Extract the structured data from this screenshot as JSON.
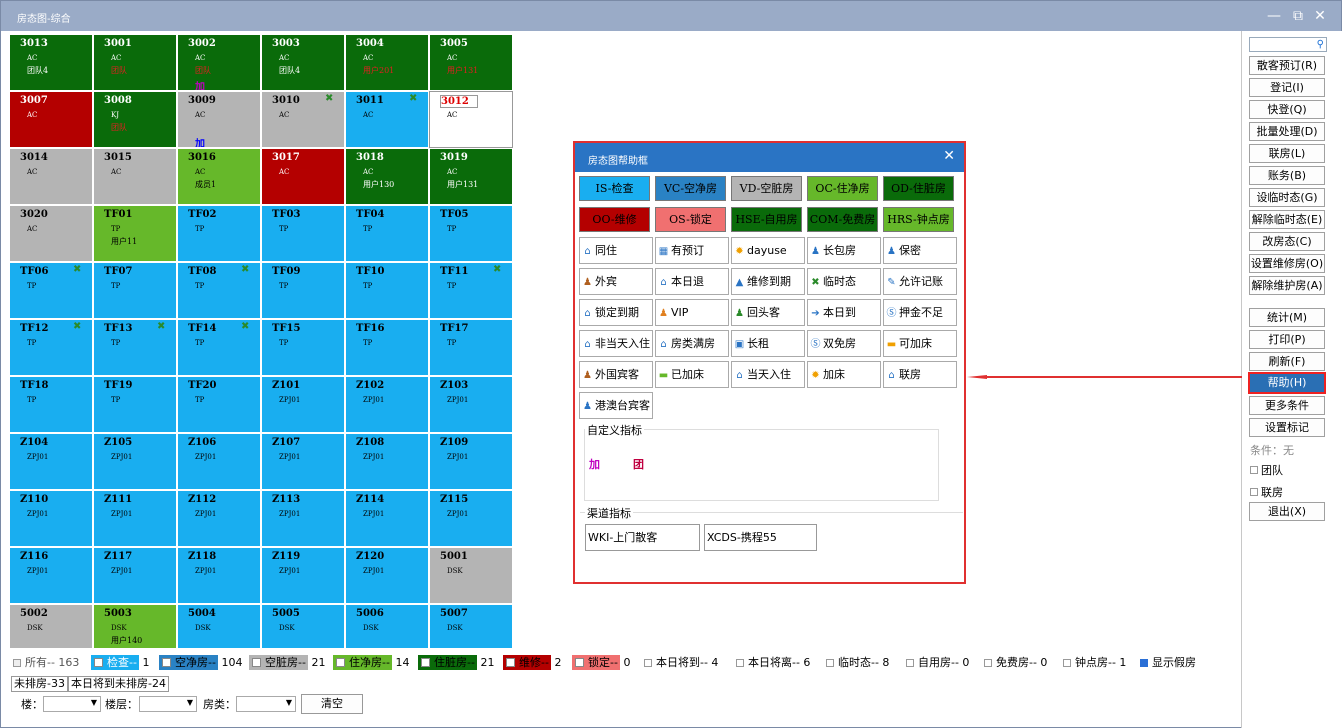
{
  "window": {
    "title": "房态图-综合",
    "minimize": "—",
    "restore": "⧉",
    "close": "✕"
  },
  "rooms": [
    {
      "num": "3013",
      "type": "AC",
      "extra": "团队4",
      "mark": "",
      "color": "green",
      "icon": false
    },
    {
      "num": "3001",
      "type": "AC",
      "extra": "团队",
      "mark": "",
      "color": "green",
      "icon": false
    },
    {
      "num": "3002",
      "type": "AC",
      "extra": "团队",
      "mark": "加",
      "color": "green",
      "icon": false
    },
    {
      "num": "3003",
      "type": "AC",
      "extra": "团队4",
      "mark": "",
      "color": "green",
      "icon": false
    },
    {
      "num": "3004",
      "type": "AC",
      "extra": "用户201",
      "mark": "",
      "color": "green",
      "icon": false
    },
    {
      "num": "3005",
      "type": "AC",
      "extra": "用户131",
      "mark": "",
      "color": "green",
      "icon": false
    },
    {
      "num": "3007",
      "type": "AC",
      "extra": "",
      "mark": "",
      "color": "red",
      "icon": false
    },
    {
      "num": "3008",
      "type": "KJ",
      "extra": "团队",
      "mark": "",
      "color": "green",
      "icon": false
    },
    {
      "num": "3009",
      "type": "AC",
      "extra": "",
      "mark": "加",
      "color": "gray",
      "icon": false
    },
    {
      "num": "3010",
      "type": "AC",
      "extra": "",
      "mark": "",
      "color": "gray",
      "icon": true
    },
    {
      "num": "3011",
      "type": "AC",
      "extra": "",
      "mark": "",
      "color": "blue",
      "icon": true
    },
    {
      "num": "3012",
      "type": "AC",
      "extra": "",
      "mark": "",
      "color": "white",
      "icon": false
    },
    {
      "num": "3014",
      "type": "AC",
      "extra": "",
      "mark": "",
      "color": "gray",
      "icon": false
    },
    {
      "num": "3015",
      "type": "AC",
      "extra": "",
      "mark": "",
      "color": "gray",
      "icon": false
    },
    {
      "num": "3016",
      "type": "AC",
      "extra": "成员1",
      "mark": "",
      "color": "lgreen",
      "icon": false
    },
    {
      "num": "3017",
      "type": "AC",
      "extra": "",
      "mark": "",
      "color": "red",
      "icon": false
    },
    {
      "num": "3018",
      "type": "AC",
      "extra": "用户130",
      "mark": "",
      "color": "green",
      "icon": false
    },
    {
      "num": "3019",
      "type": "AC",
      "extra": "用户131",
      "mark": "",
      "color": "green",
      "icon": false
    },
    {
      "num": "3020",
      "type": "AC",
      "extra": "",
      "mark": "",
      "color": "gray",
      "icon": false
    },
    {
      "num": "TF01",
      "type": "TP",
      "extra": "用户11",
      "mark": "",
      "color": "lgreen",
      "icon": false
    },
    {
      "num": "TF02",
      "type": "TP",
      "extra": "",
      "mark": "",
      "color": "blue",
      "icon": false
    },
    {
      "num": "TF03",
      "type": "TP",
      "extra": "",
      "mark": "",
      "color": "blue",
      "icon": false
    },
    {
      "num": "TF04",
      "type": "TP",
      "extra": "",
      "mark": "",
      "color": "blue",
      "icon": false
    },
    {
      "num": "TF05",
      "type": "TP",
      "extra": "",
      "mark": "",
      "color": "blue",
      "icon": false
    },
    {
      "num": "TF06",
      "type": "TP",
      "extra": "",
      "mark": "",
      "color": "blue",
      "icon": true
    },
    {
      "num": "TF07",
      "type": "TP",
      "extra": "",
      "mark": "",
      "color": "blue",
      "icon": false
    },
    {
      "num": "TF08",
      "type": "TP",
      "extra": "",
      "mark": "",
      "color": "blue",
      "icon": true
    },
    {
      "num": "TF09",
      "type": "TP",
      "extra": "",
      "mark": "",
      "color": "blue",
      "icon": false
    },
    {
      "num": "TF10",
      "type": "TP",
      "extra": "",
      "mark": "",
      "color": "blue",
      "icon": false
    },
    {
      "num": "TF11",
      "type": "TP",
      "extra": "",
      "mark": "",
      "color": "blue",
      "icon": true
    },
    {
      "num": "TF12",
      "type": "TP",
      "extra": "",
      "mark": "",
      "color": "blue",
      "icon": true
    },
    {
      "num": "TF13",
      "type": "TP",
      "extra": "",
      "mark": "",
      "color": "blue",
      "icon": true
    },
    {
      "num": "TF14",
      "type": "TP",
      "extra": "",
      "mark": "",
      "color": "blue",
      "icon": true
    },
    {
      "num": "TF15",
      "type": "TP",
      "extra": "",
      "mark": "",
      "color": "blue",
      "icon": false
    },
    {
      "num": "TF16",
      "type": "TP",
      "extra": "",
      "mark": "",
      "color": "blue",
      "icon": false
    },
    {
      "num": "TF17",
      "type": "TP",
      "extra": "",
      "mark": "",
      "color": "blue",
      "icon": false
    },
    {
      "num": "TF18",
      "type": "TP",
      "extra": "",
      "mark": "",
      "color": "blue",
      "icon": false
    },
    {
      "num": "TF19",
      "type": "TP",
      "extra": "",
      "mark": "",
      "color": "blue",
      "icon": false
    },
    {
      "num": "TF20",
      "type": "TP",
      "extra": "",
      "mark": "",
      "color": "blue",
      "icon": false
    },
    {
      "num": "Z101",
      "type": "ZPJ01",
      "extra": "",
      "mark": "",
      "color": "blue",
      "icon": false
    },
    {
      "num": "Z102",
      "type": "ZPJ01",
      "extra": "",
      "mark": "",
      "color": "blue",
      "icon": false
    },
    {
      "num": "Z103",
      "type": "ZPJ01",
      "extra": "",
      "mark": "",
      "color": "blue",
      "icon": false
    },
    {
      "num": "Z104",
      "type": "ZPJ01",
      "extra": "",
      "mark": "",
      "color": "blue",
      "icon": false
    },
    {
      "num": "Z105",
      "type": "ZPJ01",
      "extra": "",
      "mark": "",
      "color": "blue",
      "icon": false
    },
    {
      "num": "Z106",
      "type": "ZPJ01",
      "extra": "",
      "mark": "",
      "color": "blue",
      "icon": false
    },
    {
      "num": "Z107",
      "type": "ZPJ01",
      "extra": "",
      "mark": "",
      "color": "blue",
      "icon": false
    },
    {
      "num": "Z108",
      "type": "ZPJ01",
      "extra": "",
      "mark": "",
      "color": "blue",
      "icon": false
    },
    {
      "num": "Z109",
      "type": "ZPJ01",
      "extra": "",
      "mark": "",
      "color": "blue",
      "icon": false
    },
    {
      "num": "Z110",
      "type": "ZPJ01",
      "extra": "",
      "mark": "",
      "color": "blue",
      "icon": false
    },
    {
      "num": "Z111",
      "type": "ZPJ01",
      "extra": "",
      "mark": "",
      "color": "blue",
      "icon": false
    },
    {
      "num": "Z112",
      "type": "ZPJ01",
      "extra": "",
      "mark": "",
      "color": "blue",
      "icon": false
    },
    {
      "num": "Z113",
      "type": "ZPJ01",
      "extra": "",
      "mark": "",
      "color": "blue",
      "icon": false
    },
    {
      "num": "Z114",
      "type": "ZPJ01",
      "extra": "",
      "mark": "",
      "color": "blue",
      "icon": false
    },
    {
      "num": "Z115",
      "type": "ZPJ01",
      "extra": "",
      "mark": "",
      "color": "blue",
      "icon": false
    },
    {
      "num": "Z116",
      "type": "ZPJ01",
      "extra": "",
      "mark": "",
      "color": "blue",
      "icon": false
    },
    {
      "num": "Z117",
      "type": "ZPJ01",
      "extra": "",
      "mark": "",
      "color": "blue",
      "icon": false
    },
    {
      "num": "Z118",
      "type": "ZPJ01",
      "extra": "",
      "mark": "",
      "color": "blue",
      "icon": false
    },
    {
      "num": "Z119",
      "type": "ZPJ01",
      "extra": "",
      "mark": "",
      "color": "blue",
      "icon": false
    },
    {
      "num": "Z120",
      "type": "ZPJ01",
      "extra": "",
      "mark": "",
      "color": "blue",
      "icon": false
    },
    {
      "num": "5001",
      "type": "DSK",
      "extra": "",
      "mark": "",
      "color": "gray",
      "icon": false
    },
    {
      "num": "5002",
      "type": "DSK",
      "extra": "",
      "mark": "",
      "color": "gray",
      "icon": false
    },
    {
      "num": "5003",
      "type": "DSK",
      "extra": "用户140",
      "mark": "",
      "color": "lgreen",
      "icon": false
    },
    {
      "num": "5004",
      "type": "DSK",
      "extra": "",
      "mark": "",
      "color": "blue",
      "icon": false
    },
    {
      "num": "5005",
      "type": "DSK",
      "extra": "",
      "mark": "",
      "color": "blue",
      "icon": false
    },
    {
      "num": "5006",
      "type": "DSK",
      "extra": "",
      "mark": "",
      "color": "blue",
      "icon": false
    },
    {
      "num": "5007",
      "type": "DSK",
      "extra": "",
      "mark": "",
      "color": "blue",
      "icon": false
    }
  ],
  "sidebar": {
    "search_icon": "search-icon",
    "buttons": [
      "散客预订(R)",
      "登记(I)",
      "快登(Q)",
      "批量处理(D)",
      "联房(L)",
      "账务(B)",
      "设临时态(G)",
      "解除临时态(E)",
      "改房态(C)",
      "设置维修房(O)",
      "解除维护房(A)",
      "统计(M)",
      "打印(P)",
      "刷新(F)",
      "帮助(H)",
      "更多条件",
      "设置标记"
    ],
    "condition": "条件：无",
    "check_team": "团队",
    "check_link": "联房",
    "exit": "退出(X)"
  },
  "legend": {
    "all": "所有-- 163",
    "check": "检查--",
    "check_n": "1",
    "vc": "空净房--",
    "vc_n": "104",
    "vd": "空脏房--",
    "vd_n": "21",
    "oc": "住净房--",
    "oc_n": "14",
    "od": "住脏房--",
    "od_n": "21",
    "oo": "维修--",
    "oo_n": "2",
    "os": "锁定--",
    "os_n": "0",
    "arrive": "本日将到-- 4",
    "leave": "本日将离-- 6",
    "temp": "临时态-- 8",
    "self": "自用房-- 0",
    "free": "免费房-- 0",
    "hour": "钟点房-- 1",
    "show_fake": "显示假房",
    "unassigned": "未排房-33",
    "arrive_unassigned": "本日将到未排房-24",
    "building": "楼：",
    "floor": "楼层：",
    "roomtype": "房类：",
    "clear": "清空"
  },
  "colors": {
    "green": "#0a6b0a",
    "red": "#b40000",
    "gray": "#b4b4b4",
    "blue": "#19aef0",
    "lgreen": "#66b82a",
    "accent": "#2a74c4",
    "highlight": "#e03030"
  },
  "dialog": {
    "title": "房态图帮助框",
    "close": "✕",
    "statuses": [
      {
        "label": "IS-检查",
        "bg": "#19aef0",
        "fg": "#000"
      },
      {
        "label": "VC-空净房",
        "bg": "#2a82c4",
        "fg": "#000"
      },
      {
        "label": "VD-空脏房",
        "bg": "#b4b4b4",
        "fg": "#000"
      },
      {
        "label": "OC-住净房",
        "bg": "#66b82a",
        "fg": "#000"
      },
      {
        "label": "OD-住脏房",
        "bg": "#0a6b0a",
        "fg": "#000"
      },
      {
        "label": "OO-维修",
        "bg": "#b40000",
        "fg": "#000"
      },
      {
        "label": "OS-锁定",
        "bg": "#f07070",
        "fg": "#000"
      },
      {
        "label": "HSE-自用房",
        "bg": "#0a6b0a",
        "fg": "#000"
      },
      {
        "label": "COM-免费房",
        "bg": "#0a6b0a",
        "fg": "#000"
      },
      {
        "label": "HRS-钟点房",
        "bg": "#66b82a",
        "fg": "#000"
      }
    ],
    "indicators": [
      {
        "label": "同住",
        "icon": "home-icon",
        "glyph": "⌂",
        "color": "#2a74c4"
      },
      {
        "label": "有预订",
        "icon": "calendar-icon",
        "glyph": "▦",
        "color": "#2a74c4"
      },
      {
        "label": "dayuse",
        "icon": "sun-icon",
        "glyph": "✹",
        "color": "#f0a000"
      },
      {
        "label": "长包房",
        "icon": "person-key-icon",
        "glyph": "♟",
        "color": "#2a74c4"
      },
      {
        "label": "保密",
        "icon": "person-lock-icon",
        "glyph": "♟",
        "color": "#2a74c4"
      },
      {
        "label": "外宾",
        "icon": "foreigner-icon",
        "glyph": "♟",
        "color": "#b06020"
      },
      {
        "label": "本日退",
        "icon": "checkout-icon",
        "glyph": "⌂",
        "color": "#2a74c4"
      },
      {
        "label": "维修到期",
        "icon": "repair-icon",
        "glyph": "▲",
        "color": "#2a74c4"
      },
      {
        "label": "临时态",
        "icon": "tools-icon",
        "glyph": "✖",
        "color": "#2a8a2a"
      },
      {
        "label": "允许记账",
        "icon": "account-icon",
        "glyph": "✎",
        "color": "#2a74c4"
      },
      {
        "label": "锁定到期",
        "icon": "lock-home-icon",
        "glyph": "⌂",
        "color": "#2a74c4"
      },
      {
        "label": "VIP",
        "icon": "vip-icon",
        "glyph": "♟",
        "color": "#e08020"
      },
      {
        "label": "回头客",
        "icon": "returning-guest-icon",
        "glyph": "♟",
        "color": "#2a8a2a"
      },
      {
        "label": "本日到",
        "icon": "arrival-icon",
        "glyph": "➔",
        "color": "#2a74c4"
      },
      {
        "label": "押金不足",
        "icon": "deposit-icon",
        "glyph": "Ⓢ",
        "color": "#2a74c4"
      },
      {
        "label": "非当天入住",
        "icon": "house-icon",
        "glyph": "⌂",
        "color": "#2a74c4"
      },
      {
        "label": "房类满房",
        "icon": "house-full-icon",
        "glyph": "⌂",
        "color": "#2a74c4"
      },
      {
        "label": "长租",
        "icon": "long-rent-icon",
        "glyph": "▣",
        "color": "#2a74c4"
      },
      {
        "label": "双免房",
        "icon": "double-free-icon",
        "glyph": "Ⓢ",
        "color": "#2a74c4"
      },
      {
        "label": "可加床",
        "icon": "bed-icon",
        "glyph": "▬",
        "color": "#f0a000"
      },
      {
        "label": "外国宾客",
        "icon": "foreign-guest-icon",
        "glyph": "♟",
        "color": "#b06020"
      },
      {
        "label": "已加床",
        "icon": "bed-added-icon",
        "glyph": "▬",
        "color": "#66b82a"
      },
      {
        "label": "当天入住",
        "icon": "today-checkin-icon",
        "glyph": "⌂",
        "color": "#2a74c4"
      },
      {
        "label": "加床",
        "icon": "add-bed-icon",
        "glyph": "✹",
        "color": "#f0a000"
      },
      {
        "label": "联房",
        "icon": "linked-room-icon",
        "glyph": "⌂",
        "color": "#2a74c4"
      },
      {
        "label": "港澳台宾客",
        "icon": "hk-guest-icon",
        "glyph": "♟",
        "color": "#2a74c4"
      }
    ],
    "custom_label": "自定义指标",
    "custom_marks": [
      {
        "text": "加",
        "color": "#c000c0"
      },
      {
        "text": "团",
        "color": "#c00040"
      }
    ],
    "channel_label": "渠道指标",
    "channels": [
      "WKI-上门散客",
      "XCDS-携程55"
    ]
  }
}
